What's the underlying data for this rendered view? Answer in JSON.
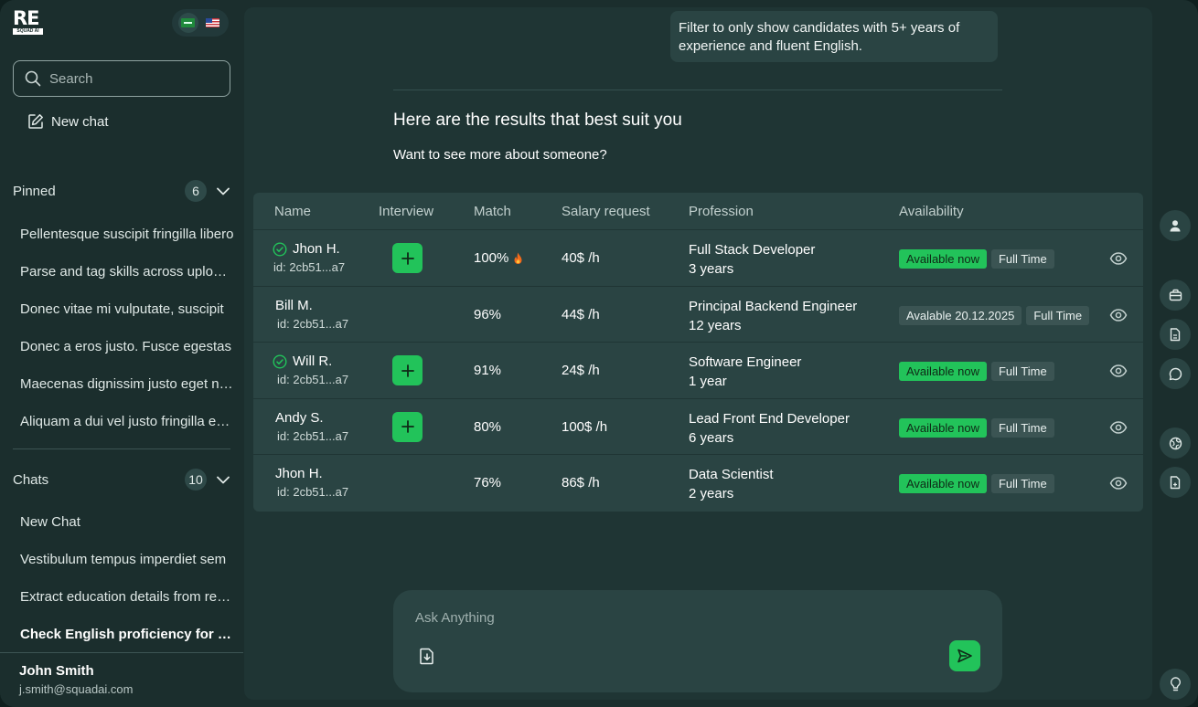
{
  "logo": {
    "main": "RE",
    "sub": "SQUAD AI"
  },
  "languages": [
    "sa-flag-icon",
    "us-flag-icon"
  ],
  "search": {
    "placeholder": "Search"
  },
  "new_chat_label": "New chat",
  "pinned": {
    "label": "Pinned",
    "count": "6",
    "items": [
      "Pellentesque suscipit fringilla libero",
      "Parse and tag skills across uploaded",
      "Donec vitae mi vulputate, suscipit",
      "Donec a eros justo. Fusce egestas",
      "Maecenas dignissim justo eget nulla",
      "Aliquam a dui vel justo fringilla euismod"
    ]
  },
  "chats": {
    "label": "Chats",
    "count": "10",
    "items": [
      "New Chat",
      "Vestibulum tempus imperdiet sem",
      "Extract education details from resumes",
      "Check English proficiency for all candidates"
    ]
  },
  "user": {
    "name": "John Smith",
    "email": "j.smith@squadai.com"
  },
  "conversation": {
    "user_message": "Filter to only show candidates with 5+ years of experience and fluent English.",
    "title": "Here are the results that best suit you",
    "subtitle": "Want to see more about someone?"
  },
  "table": {
    "headers": {
      "name": "Name",
      "interview": "Interview",
      "match": "Match",
      "salary": "Salary request",
      "profession": "Profession",
      "availability": "Availability"
    },
    "rows": [
      {
        "name": "Jhon H.",
        "id": "id: 2cb51...a7",
        "verified": true,
        "interview": true,
        "match": "100%",
        "hot": true,
        "salary": "40$ /h",
        "profession": "Full Stack Developer",
        "experience": "3 years",
        "availability": "Available now",
        "availability_status": "green",
        "type": "Full Time"
      },
      {
        "name": "Bill M.",
        "id": "id: 2cb51...a7",
        "verified": false,
        "interview": false,
        "match": "96%",
        "hot": false,
        "salary": "44$ /h",
        "profession": "Principal Backend Engineer",
        "experience": "12 years",
        "availability": "Avalable 20.12.2025",
        "availability_status": "grey",
        "type": "Full Time"
      },
      {
        "name": "Will R.",
        "id": "id: 2cb51...a7",
        "verified": true,
        "interview": true,
        "match": "91%",
        "hot": false,
        "salary": "24$ /h",
        "profession": "Software Engineer",
        "experience": "1 year",
        "availability": "Available now",
        "availability_status": "green",
        "type": "Full Time"
      },
      {
        "name": "Andy S.",
        "id": "id: 2cb51...a7",
        "verified": false,
        "interview": true,
        "match": "80%",
        "hot": false,
        "salary": "100$ /h",
        "profession": "Lead Front End Developer",
        "experience": "6 years",
        "availability": "Available now",
        "availability_status": "green",
        "type": "Full Time"
      },
      {
        "name": "Jhon H.",
        "id": "id: 2cb51...a7",
        "verified": false,
        "interview": false,
        "match": "76%",
        "hot": false,
        "salary": "86$ /h",
        "profession": "Data Scientist",
        "experience": "2 years",
        "availability": "Available now",
        "availability_status": "green",
        "type": "Full Time"
      }
    ]
  },
  "composer": {
    "placeholder": "Ask Anything"
  },
  "rail_icons": [
    "user-icon",
    "briefcase-icon",
    "document-icon",
    "chat-icon",
    "globe-icon",
    "file-icon",
    "lightbulb-icon"
  ],
  "colors": {
    "accent": "#22c35a",
    "background": "#1b2e2d",
    "panel": "#1f3534",
    "card": "#2a4443"
  }
}
